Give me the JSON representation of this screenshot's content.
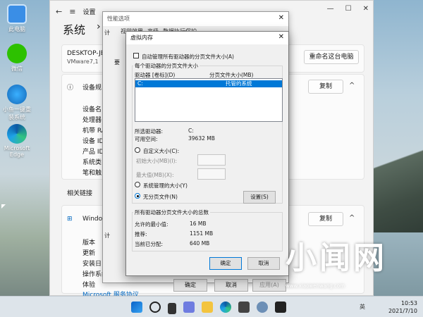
{
  "desktop": {
    "icons": [
      {
        "label": "此电脑"
      },
      {
        "label": "微信"
      },
      {
        "label": "小鱼一键重装系统"
      },
      {
        "label": "Microsoft Edge"
      }
    ]
  },
  "settings": {
    "window_title": "设置",
    "page_title": "系统",
    "device_name": "DESKTOP-JBIF",
    "device_sub": "VMware7,1",
    "rename_button": "重命名这台电脑",
    "device_spec_title": "设备规",
    "copy_label": "复制",
    "spec_rows": [
      "设备名",
      "处理器",
      "机带 RA",
      "设备 ID",
      "产品 ID",
      "系统类",
      "笔和触"
    ],
    "related_links": "相关链接",
    "windows_spec_title": "Window",
    "win_rows": [
      "版本",
      "更新",
      "安装日",
      "操作系统版",
      "体验"
    ],
    "ms_link": "Microsoft 服务协议"
  },
  "perf_dialog": {
    "title": "性能选项",
    "tabs": [
      "视觉效果",
      "高级",
      "数据执行保护"
    ],
    "ok": "确定",
    "cancel": "取消",
    "apply": "应用(A)",
    "side_labels": [
      "计",
      "要",
      "计"
    ]
  },
  "vm_dialog": {
    "title": "虚拟内存",
    "auto_manage": "自动管理所有驱动器的分页文件大小(A)",
    "per_drive_group": "每个驱动器的分页文件大小",
    "col_drive": "驱动器 [卷标](D)",
    "col_size": "分页文件大小(MB)",
    "selected_row_drive": "C:",
    "selected_row_size": "托管的系统",
    "selected_drive_label": "所选驱动器:",
    "selected_drive_value": "C:",
    "free_space_label": "可用空间:",
    "free_space_value": "39632 MB",
    "custom_size": "自定义大小(C):",
    "initial_size": "初始大小(MB)(I):",
    "max_size": "最大值(MB)(X):",
    "system_managed": "系统管理的大小(Y)",
    "no_paging": "无分页文件(N)",
    "set_button": "设置(S)",
    "total_group": "所有驱动器分页文件大小的总数",
    "min_allowed_label": "允许的最小值:",
    "min_allowed_value": "16 MB",
    "recommended_label": "推荐:",
    "recommended_value": "1151 MB",
    "current_label": "当前已分配:",
    "current_value": "640 MB",
    "ok": "确定",
    "cancel": "取消"
  },
  "watermark": {
    "big": "小闻网",
    "small": "www.xiaowenwang.com"
  },
  "taskbar": {
    "time": "10:53",
    "date": "2021/7/10",
    "tray_text": "英"
  }
}
